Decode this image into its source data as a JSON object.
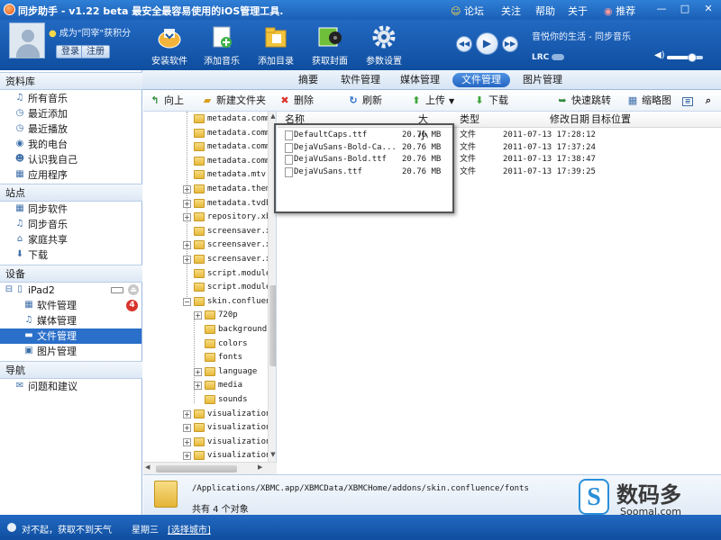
{
  "titlebar": {
    "title": "同步助手 - v1.22 beta  最安全最容易使用的iOS管理工具.",
    "links": {
      "forum": "论坛",
      "follow": "关注",
      "help": "帮助",
      "about": "关于",
      "recommend": "推荐"
    },
    "min": "—",
    "max": "□",
    "close": "✕"
  },
  "header": {
    "promo": "成为\"同宰\"获积分",
    "login": "登录",
    "register": "注册",
    "tools": [
      {
        "label": "安装软件",
        "icon": "install-software-icon"
      },
      {
        "label": "添加音乐",
        "icon": "add-music-icon"
      },
      {
        "label": "添加目录",
        "icon": "add-directory-icon"
      },
      {
        "label": "获取封面",
        "icon": "get-cover-icon"
      },
      {
        "label": "参数设置",
        "icon": "settings-gear-icon"
      }
    ],
    "player": {
      "song": "音悦你的生活 - 同步音乐",
      "lrc": "LRC",
      "volume": 0.7
    }
  },
  "tabs": [
    "摘要",
    "软件管理",
    "媒体管理",
    "文件管理",
    "图片管理"
  ],
  "active_tab": "文件管理",
  "sidebar": {
    "library": {
      "title": "资料库",
      "items": [
        "所有音乐",
        "最近添加",
        "最近播放",
        "我的电台",
        "认识我自己",
        "应用程序"
      ]
    },
    "sites": {
      "title": "站点",
      "items": [
        "同步软件",
        "同步音乐",
        "家庭共享",
        "下载"
      ]
    },
    "devices": {
      "title": "设备",
      "device": "iPad2",
      "items": [
        "软件管理",
        "媒体管理",
        "文件管理",
        "图片管理"
      ],
      "badge": "4"
    },
    "nav": {
      "title": "导航",
      "items": [
        "问题和建议"
      ]
    }
  },
  "toolbar": {
    "up": "向上",
    "new_folder": "新建文件夹",
    "delete": "删除",
    "refresh": "刷新",
    "upload": "上传",
    "download": "下载",
    "quick_jump": "快速跳转",
    "thumbnail": "缩略图"
  },
  "tree": [
    "metadata.common",
    "metadata.common",
    "metadata.common",
    "metadata.common",
    "metadata.mtv.c",
    "metadata.themo",
    "metadata.tvdb.",
    "repository.xbm",
    "screensaver.xbm",
    "screensaver.xbm",
    "screensaver.xbm",
    "script.module.",
    "script.module.s",
    "skin.confluence",
    "720p",
    "backgrounds",
    "colors",
    "fonts",
    "language",
    "media",
    "sounds",
    "visualization.",
    "visualization.",
    "visualization.",
    "visualization.r"
  ],
  "files": {
    "columns": {
      "name": "名称",
      "size": "大小",
      "type": "类型",
      "modified": "修改日期",
      "target": "目标位置"
    },
    "rows": [
      {
        "name": "DefaultCaps.ttf",
        "size": "20.76 MB",
        "type": "文件",
        "modified": "2011-07-13 17:28:12"
      },
      {
        "name": "DejaVuSans-Bold-Ca...",
        "size": "20.76 MB",
        "type": "文件",
        "modified": "2011-07-13 17:37:24"
      },
      {
        "name": "DejaVuSans-Bold.ttf",
        "size": "20.76 MB",
        "type": "文件",
        "modified": "2011-07-13 17:38:47"
      },
      {
        "name": "DejaVuSans.ttf",
        "size": "20.76 MB",
        "type": "文件",
        "modified": "2011-07-13 17:39:25"
      }
    ]
  },
  "pathbar": {
    "path": "/Applications/XBMC.app/XBMCData/XBMCHome/addons/skin.confluence/fonts",
    "count": "共有 4 个对象"
  },
  "statusbar": {
    "weather": "对不起，获取不到天气",
    "day": "星期三",
    "choose_city": "[选择城市]"
  },
  "watermark": {
    "cn": "数码多",
    "en": "Soomal.com"
  },
  "colors": {
    "brand": "#1b5fb6",
    "selected": "#2a6fc9",
    "badge": "#d9342b"
  }
}
